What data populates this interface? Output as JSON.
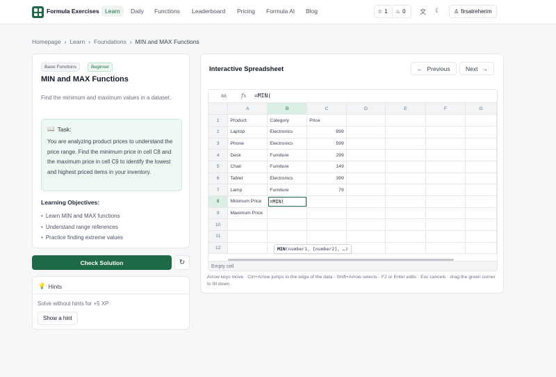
{
  "nav": {
    "brand": "Formula Exercises",
    "links": [
      "Learn",
      "Daily",
      "Functions",
      "Leaderboard",
      "Pricing",
      "Formula AI",
      "Blog"
    ],
    "star_count": "1",
    "flame_count": "0",
    "username": "firsatreherim"
  },
  "breadcrumb": [
    "Homepage",
    "Learn",
    "Foundations",
    "MIN and MAX Functions"
  ],
  "lesson": {
    "badges": [
      "Basic Functions",
      "Beginner"
    ],
    "title": "MIN and MAX Functions",
    "description": "Find the minimum and maximum values in a dataset.",
    "task_label": "Task:",
    "task_text": "You are analyzing product prices to understand the price range. Find the minimum price in cell C8 and the maximum price in cell C9 to identify the lowest and highest priced items in your inventory.",
    "objectives_title": "Learning Objectives:",
    "objectives": [
      "Learn MIN and MAX functions",
      "Understand range references",
      "Practice finding extreme values"
    ]
  },
  "actions": {
    "check_label": "Check Solution"
  },
  "hints": {
    "title": "Hints",
    "text": "Solve without hints for +5 XP",
    "button": "Show a hint"
  },
  "spreadsheet": {
    "title": "Interactive Spreadsheet",
    "prev_label": "Previous",
    "next_label": "Next",
    "cell_ref": "B8",
    "fx": "fx",
    "formula": "=MIN(",
    "columns": [
      "A",
      "B",
      "C",
      "D",
      "E",
      "F",
      "G"
    ],
    "rows": [
      [
        "Product",
        "Category",
        "Price"
      ],
      [
        "Laptop",
        "Electronics",
        "899"
      ],
      [
        "Phone",
        "Electronics",
        "599"
      ],
      [
        "Desk",
        "Furniture",
        "299"
      ],
      [
        "Chair",
        "Furniture",
        "149"
      ],
      [
        "Tablet",
        "Electronics",
        "399"
      ],
      [
        "Lamp",
        "Furniture",
        "79"
      ],
      [
        "Minimum Price",
        "=MIN(",
        ""
      ],
      [
        "Maximum Price",
        "",
        ""
      ],
      [
        "",
        "",
        ""
      ],
      [
        "",
        "",
        ""
      ],
      [
        "",
        "",
        ""
      ]
    ],
    "tooltip_fn": "MIN",
    "tooltip_args": "(number1, [number2], …)",
    "status": "Empty cell",
    "help": "Arrow keys move · Ctrl+Arrow jumps to the edge of the data · Shift+Arrow selects · F2 or Enter edits · Esc cancels · drag the green corner to fill down"
  },
  "colors": {
    "accent": "#1e6a47",
    "accent_light": "#eef8f2"
  }
}
